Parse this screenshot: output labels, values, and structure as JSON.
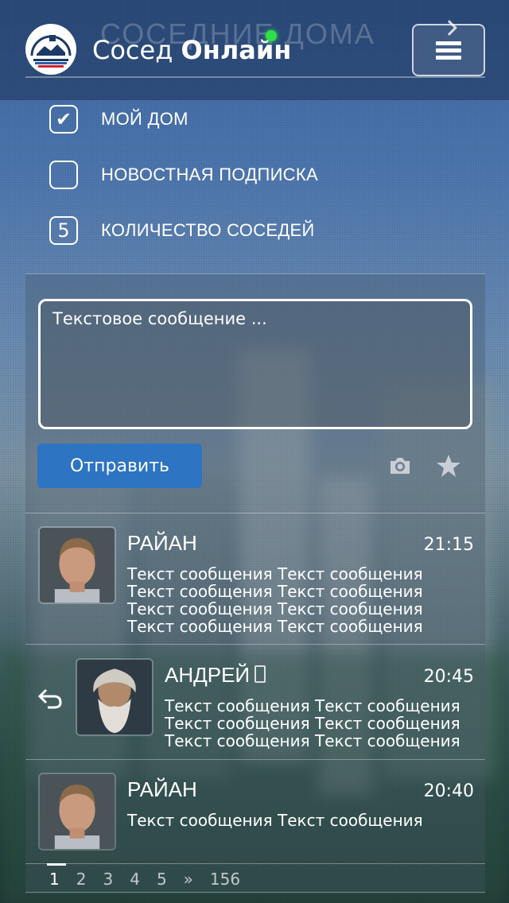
{
  "header": {
    "ghost_title": "СОСЕДНИЕ ДОМА",
    "title_regular": "Сосед ",
    "title_bold": "Онлайн",
    "menu_icon": "hamburger-icon"
  },
  "options": [
    {
      "label": "МОЙ ДОМ",
      "mark": "✔",
      "checked": true
    },
    {
      "label": "НОВОСТНАЯ ПОДПИСКА",
      "mark": "",
      "checked": false
    },
    {
      "label": "КОЛИЧЕСТВО СОСЕДЕЙ",
      "mark": "5",
      "checked": false
    }
  ],
  "composer": {
    "placeholder": "Текстовое сообщение ...",
    "send_label": "Отправить",
    "icons": [
      "camera-icon",
      "star-icon"
    ]
  },
  "messages": [
    {
      "author": "РАЙАН",
      "time": "21:15",
      "text": "Текст сообщения Текст сообщения\nТекст сообщения Текст сообщения\nТекст сообщения Текст сообщения\nТекст сообщения Текст сообщения"
    },
    {
      "author": "АНДРЕЙ",
      "time": "20:45",
      "text": "Текст сообщения Текст сообщения\nТекст сообщения Текст сообщения\nТекст сообщения Текст сообщения",
      "reply": true
    },
    {
      "author": "РАЙАН",
      "time": "20:40",
      "text": "Текст сообщения Текст сообщения"
    }
  ],
  "pagination": [
    "1",
    "2",
    "3",
    "4",
    "5",
    "»",
    "156"
  ],
  "colors": {
    "accent": "#2d74c2",
    "online": "#2fe04a"
  }
}
